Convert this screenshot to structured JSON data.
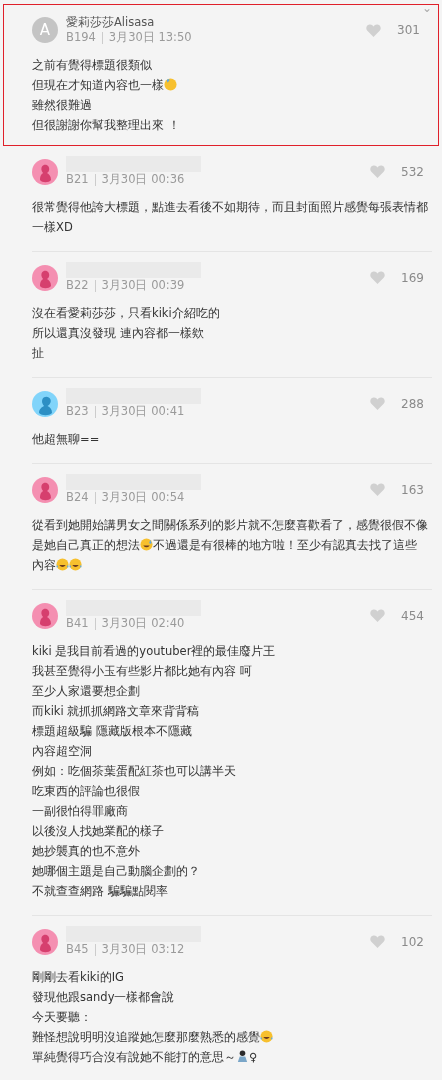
{
  "comments": [
    {
      "author": "愛莉莎莎Alisasa",
      "name_redacted": false,
      "highlighted": true,
      "avatar": {
        "kind": "letter",
        "letter": "A"
      },
      "floor": "B194",
      "date": "3月30日 13:50",
      "likes": "301",
      "menu": "⌄",
      "lines": [
        [
          {
            "kind": "text",
            "text": "之前有覺得標題很類似"
          }
        ],
        [
          {
            "kind": "text",
            "text": "但現在才知道內容也一樣"
          },
          {
            "kind": "emoji-sweat"
          }
        ],
        [
          {
            "kind": "text",
            "text": "雖然很難過"
          }
        ],
        [
          {
            "kind": "text",
            "text": "但很謝謝你幫我整理出來 ！"
          }
        ]
      ]
    },
    {
      "name_redacted": true,
      "highlighted": false,
      "avatar": {
        "kind": "female"
      },
      "floor": "B21",
      "date": "3月30日 00:36",
      "likes": "532",
      "lines": [
        [
          {
            "kind": "text",
            "text": "很常覺得他誇大標題，點進去看後不如期待，而且封面照片感覺每張表情都"
          }
        ],
        [
          {
            "kind": "text",
            "text": "一樣XD"
          }
        ]
      ]
    },
    {
      "name_redacted": true,
      "highlighted": false,
      "avatar": {
        "kind": "female"
      },
      "floor": "B22",
      "date": "3月30日 00:39",
      "likes": "169",
      "lines": [
        [
          {
            "kind": "text",
            "text": "沒在看愛莉莎莎，只看kiki介紹吃的"
          }
        ],
        [
          {
            "kind": "text",
            "text": "所以還真沒發現 連內容都一樣欸"
          }
        ],
        [
          {
            "kind": "text",
            "text": "扯"
          }
        ]
      ]
    },
    {
      "name_redacted": true,
      "highlighted": false,
      "avatar": {
        "kind": "male"
      },
      "floor": "B23",
      "date": "3月30日 00:41",
      "likes": "288",
      "lines": [
        [
          {
            "kind": "text",
            "text": "他超無聊=="
          }
        ]
      ]
    },
    {
      "name_redacted": true,
      "highlighted": false,
      "avatar": {
        "kind": "female"
      },
      "floor": "B24",
      "date": "3月30日 00:54",
      "likes": "163",
      "lines": [
        [
          {
            "kind": "text",
            "text": "從看到她開始講男女之間關係系列的影片就不怎麼喜歡看了，感覺很假不像"
          }
        ],
        [
          {
            "kind": "text",
            "text": "是她自己真正的想法"
          },
          {
            "kind": "emoji-sweat-smile"
          },
          {
            "kind": "text",
            "text": "不過還是有很棒的地方啦！至少有認真去找了這些"
          }
        ],
        [
          {
            "kind": "text",
            "text": "內容"
          },
          {
            "kind": "emoji-tears"
          },
          {
            "kind": "emoji-tears"
          }
        ]
      ]
    },
    {
      "name_redacted": true,
      "highlighted": false,
      "avatar": {
        "kind": "female"
      },
      "floor": "B41",
      "date": "3月30日 02:40",
      "likes": "454",
      "lines": [
        [
          {
            "kind": "text",
            "text": "kiki 是我目前看過的youtuber裡的最佳廢片王"
          }
        ],
        [
          {
            "kind": "text",
            "text": "我甚至覺得小玉有些影片都比她有內容 呵"
          }
        ],
        [
          {
            "kind": "text",
            "text": "至少人家還要想企劃"
          }
        ],
        [
          {
            "kind": "text",
            "text": "而kiki 就抓抓網路文章來背背稿"
          }
        ],
        [
          {
            "kind": "text",
            "text": "標題超級騙 隱藏版根本不隱藏"
          }
        ],
        [
          {
            "kind": "text",
            "text": "內容超空洞"
          }
        ],
        [
          {
            "kind": "text",
            "text": "例如：吃個茶葉蛋配紅茶也可以講半天"
          }
        ],
        [
          {
            "kind": "text",
            "text": "吃東西的評論也很假"
          }
        ],
        [
          {
            "kind": "text",
            "text": "一副很怕得罪廠商"
          }
        ],
        [
          {
            "kind": "text",
            "text": "以後沒人找她業配的樣子"
          }
        ],
        [
          {
            "kind": "text",
            "text": "她抄襲真的也不意外"
          }
        ],
        [
          {
            "kind": "text",
            "text": "她哪個主題是自己動腦企劃的？"
          }
        ],
        [
          {
            "kind": "text",
            "text": "不就查查網路 騙騙點閱率"
          }
        ]
      ]
    },
    {
      "name_redacted": true,
      "highlighted": false,
      "avatar": {
        "kind": "female"
      },
      "floor": "B45",
      "date": "3月30日 03:12",
      "likes": "102",
      "lines": [
        [
          {
            "kind": "text",
            "text": "剛剛去看kiki的IG"
          }
        ],
        [
          {
            "kind": "text",
            "text": "發現他跟sandy一樣都會說"
          }
        ],
        [
          {
            "kind": "text",
            "text": "今天要聽："
          }
        ],
        [
          {
            "kind": "text",
            "text": "難怪想說明明沒追蹤她怎麼那麼熟悉的感覺"
          },
          {
            "kind": "emoji-tears"
          }
        ],
        [
          {
            "kind": "text",
            "text": "單純覺得巧合沒有說她不能打的意思～"
          },
          {
            "kind": "emoji-person"
          },
          {
            "kind": "text",
            "text": "♀"
          }
        ]
      ]
    }
  ]
}
